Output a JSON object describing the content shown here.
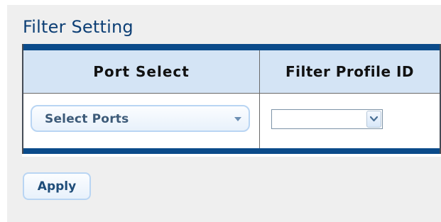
{
  "page": {
    "title": "Filter Setting"
  },
  "table": {
    "headers": [
      "Port Select",
      "Filter Profile ID"
    ],
    "port_select": {
      "value": "Select Ports",
      "icon": "chevron-down-icon"
    },
    "filter_profile_id": {
      "value": "",
      "icon": "dropdown-arrow-icon"
    }
  },
  "actions": {
    "apply_label": "Apply"
  },
  "colors": {
    "title": "#0d3f75",
    "table_border": "#0b4b8a",
    "header_bg": "#d4e4f5",
    "button_border": "#b9d5f3",
    "button_text": "#1f4d79"
  }
}
